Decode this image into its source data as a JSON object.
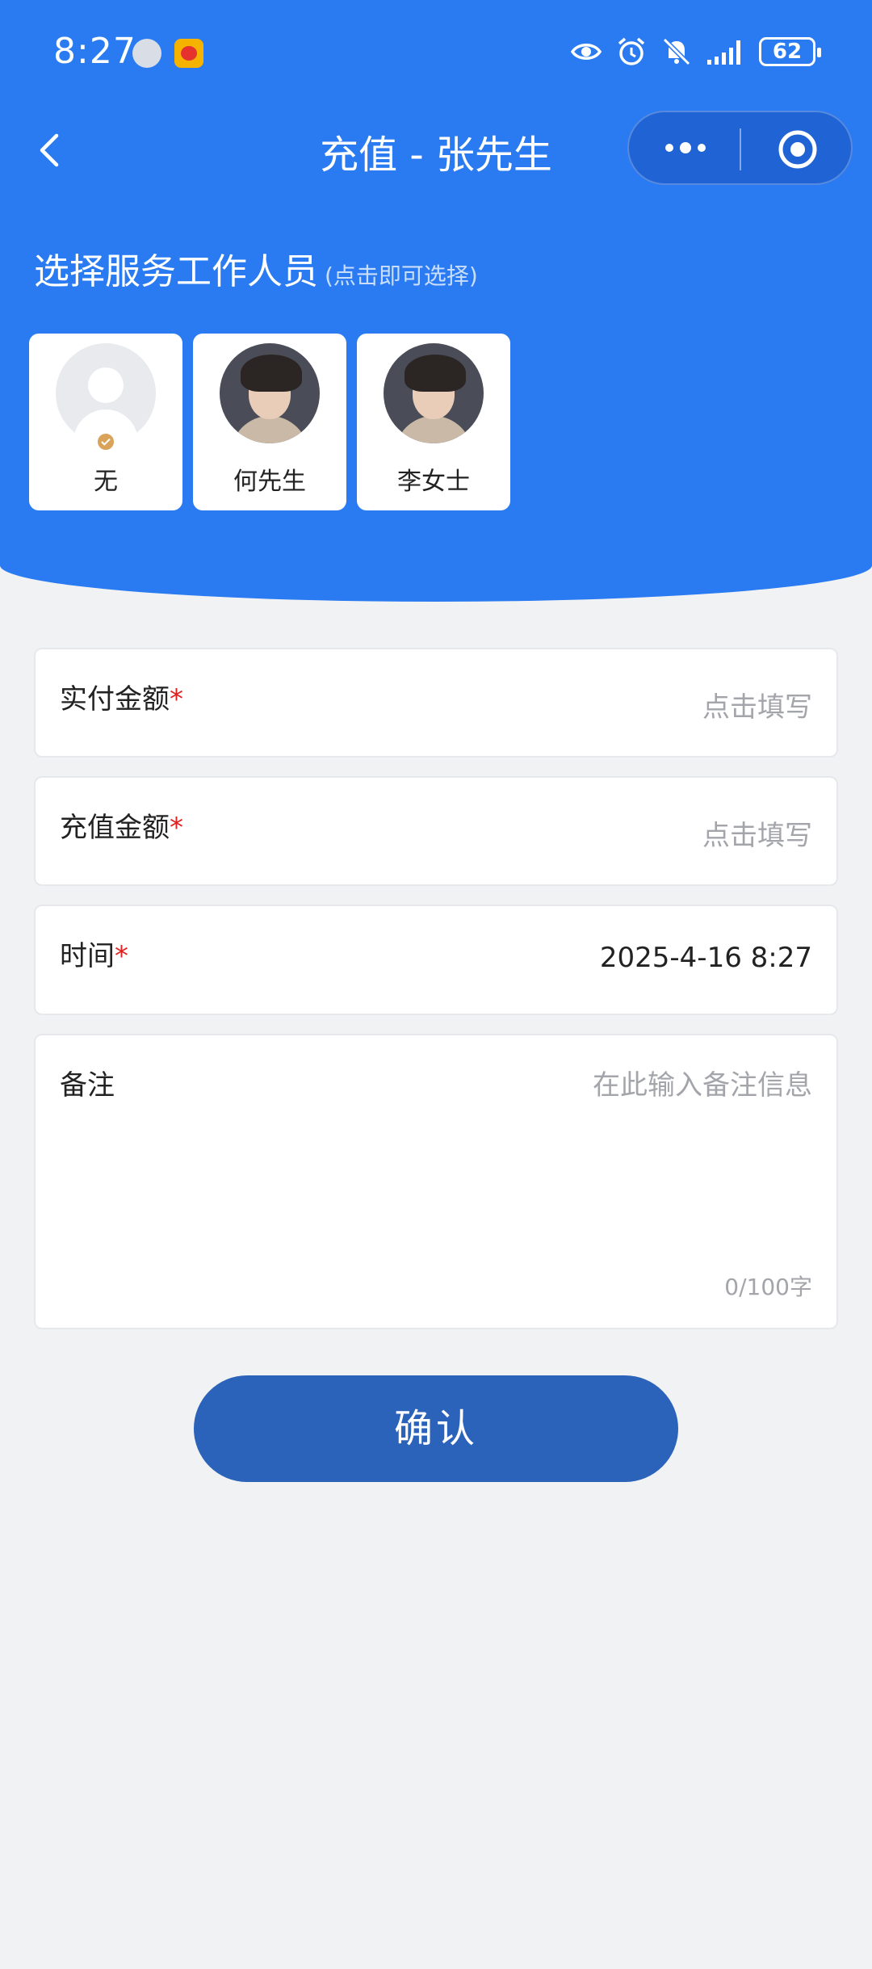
{
  "status_bar": {
    "time": "8:27",
    "battery": "62",
    "icons": [
      "app-avatar-icon",
      "weibo-icon",
      "eye-icon",
      "alarm-icon",
      "mute-bell-icon",
      "signal-icon",
      "battery-icon"
    ]
  },
  "nav": {
    "title": "充值 - 张先生",
    "back_icon": "chevron-left-icon",
    "more_icon": "more-dots-icon",
    "close_icon": "target-circle-icon"
  },
  "staff_section": {
    "title": "选择服务工作人员",
    "hint": "(点击即可选择)",
    "staff": [
      {
        "name": "无",
        "avatar": "default-avatar",
        "selected": true
      },
      {
        "name": "何先生",
        "avatar": "person-avatar",
        "selected": false
      },
      {
        "name": "李女士",
        "avatar": "person-avatar",
        "selected": false
      }
    ]
  },
  "form": {
    "paid_amount": {
      "label": "实付金额",
      "required_mark": "*",
      "placeholder": "点击填写"
    },
    "recharge_amount": {
      "label": "充值金额",
      "required_mark": "*",
      "placeholder": "点击填写"
    },
    "time": {
      "label": "时间",
      "required_mark": "*",
      "value": "2025-4-16 8:27"
    },
    "remark": {
      "label": "备注",
      "placeholder": "在此输入备注信息",
      "counter": "0/100字"
    }
  },
  "confirm_label": "确认",
  "colors": {
    "header_blue": "#2a7bf1",
    "button_blue": "#2b63bb",
    "required_red": "#e02020",
    "background": "#f1f2f4"
  }
}
